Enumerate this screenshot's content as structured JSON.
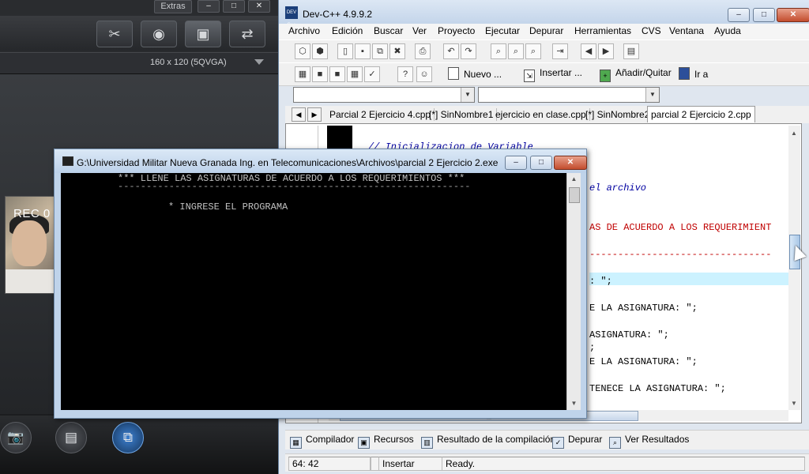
{
  "webcam": {
    "extras_label": "Extras",
    "window_buttons": [
      "–",
      "□",
      "✕"
    ],
    "toolbar_icons": [
      "tools-icon",
      "webcam-icon",
      "screen-capture-icon",
      "camera-switch-icon"
    ],
    "resolution": "160 x 120 (5QVGA)",
    "rec_label": "REC 0",
    "bottom_buttons": [
      "📷",
      "▤",
      "⧉"
    ]
  },
  "console": {
    "title": "G:\\Universidad Militar Nueva Granada Ing. en Telecomunicaciones\\Archivos\\parcial 2 Ejercicio 2.exe",
    "line1": "*** LLENE LAS ASIGNATURAS DE ACUERDO A LOS REQUERIMIENTOS ***",
    "line2": "--------------------------------------------------------------",
    "line3": "* INGRESE EL PROGRAMA",
    "btn_min": "–",
    "btn_max": "□",
    "btn_close": "✕"
  },
  "devcpp": {
    "title": "Dev-C++ 4.9.9.2",
    "logo": "DEV C++",
    "btn_min": "–",
    "btn_max": "□",
    "btn_close": "✕",
    "menu": [
      "Archivo",
      "Edición",
      "Buscar",
      "Ver",
      "Proyecto",
      "Ejecutar",
      "Depurar",
      "Herramientas",
      "CVS",
      "Ventana",
      "Ayuda"
    ],
    "toolbar2": {
      "nuevo": "Nuevo ...",
      "insertar": "Insertar ...",
      "anadir": "Añadir/Quitar",
      "ir_a": "Ir a"
    },
    "tabs": [
      "Parcial 2 Ejercicio 4.cpp",
      "[*] SinNombre1",
      "ejercicio en clase.cpp",
      "[*] SinNombre2",
      "parcial 2 Ejercicio 2.cpp"
    ],
    "code": {
      "comment1": "// Inicializacion de Variable",
      "comment2": "el archivo",
      "red1": "AS DE ACUERDO A LOS REQUERIMIENT",
      "red2": "--------------------------------",
      "plain1": ": \";",
      "plain2": "E LA ASIGNATURA: \";",
      "plain3": "ASIGNATURA: \";",
      "plain4": ";",
      "plain5": "E LA ASIGNATURA: \";",
      "plain6": "TENECE LA ASIGNATURA: \";"
    },
    "bottom_tabs": {
      "compilador": "Compilador",
      "recursos": "Recursos",
      "resultado": "Resultado de la compilación",
      "depurar": "Depurar",
      "ver": "Ver Resultados"
    },
    "status": {
      "position": "64: 42",
      "mode": "Insertar",
      "state": "Ready."
    }
  }
}
